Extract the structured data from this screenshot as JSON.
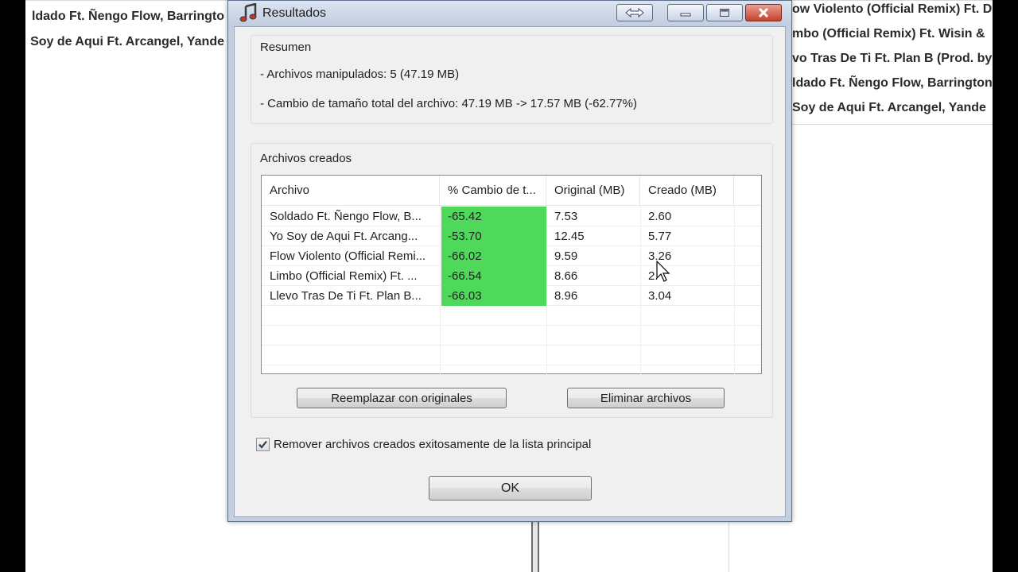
{
  "background_list": {
    "left_rows": [
      "ldado Ft. Ñengo Flow, Barringto",
      "Soy de Aqui Ft. Arcangel, Yande"
    ],
    "right_rows": [
      "ow Violento (Official Remix) Ft. D",
      "mbo (Official Remix) Ft. Wisin &",
      "vo Tras De Ti Ft. Plan B (Prod. by",
      "ldado Ft. Ñengo Flow, Barrington",
      "Soy de Aqui Ft. Arcangel, Yande"
    ]
  },
  "window": {
    "title": "Resultados",
    "title_icon": "music-note-icon",
    "buttons": [
      "resize-icon",
      "minimize-icon",
      "maximize-icon",
      "close-icon"
    ]
  },
  "summary": {
    "title": "Resumen",
    "files_handled": "- Archivos manipulados: 5  (47.19 MB)",
    "size_change": "- Cambio de tamaño total del archivo: 47.19 MB -> 17.57 MB  (-62.77%)"
  },
  "created_files": {
    "title": "Archivos creados",
    "columns": [
      "Archivo",
      "% Cambio de t...",
      "Original (MB)",
      "Creado (MB)"
    ],
    "rows": [
      {
        "file": "Soldado Ft. Ñengo Flow, B...",
        "change": "-65.42",
        "original": "7.53",
        "created": "2.60"
      },
      {
        "file": "Yo Soy de Aqui Ft. Arcang...",
        "change": "-53.70",
        "original": "12.45",
        "created": "5.77"
      },
      {
        "file": "Flow Violento (Official Remi...",
        "change": "-66.02",
        "original": "9.59",
        "created": "3.26"
      },
      {
        "file": "Limbo (Official Remix) Ft. ...",
        "change": "-66.54",
        "original": "8.66",
        "created": "2."
      },
      {
        "file": "Llevo Tras De Ti Ft. Plan B...",
        "change": "-66.03",
        "original": "8.96",
        "created": "3.04"
      }
    ],
    "replace_button": "Reemplazar con originales",
    "delete_button": "Eliminar archivos"
  },
  "remove_option": {
    "checked": true,
    "label": "Remover archivos creados exitosamente de la lista principal"
  },
  "ok_button": "OK",
  "colors": {
    "change_cell": "#4fd95a",
    "frame": "#c4cfe0",
    "client": "#f0f0f0"
  }
}
